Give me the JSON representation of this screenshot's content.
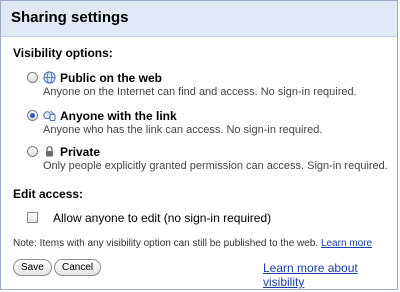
{
  "dialog": {
    "title": "Sharing settings"
  },
  "visibility": {
    "label": "Visibility options:",
    "options": [
      {
        "label": "Public on the web",
        "description": "Anyone on the Internet can find and access. No sign-in required.",
        "icon": "globe-icon",
        "selected": false
      },
      {
        "label": "Anyone with the link",
        "description": "Anyone who has the link can access. No sign-in required.",
        "icon": "link-icon",
        "selected": true
      },
      {
        "label": "Private",
        "description": "Only people explicitly granted permission can access. Sign-in required.",
        "icon": "lock-icon",
        "selected": false
      }
    ]
  },
  "edit_access": {
    "label": "Edit access:",
    "checkbox_label": "Allow anyone to edit (no sign-in required)",
    "checked": false
  },
  "note": {
    "text": "Note: Items with any visibility option can still be published to the web.",
    "link": "Learn more"
  },
  "buttons": {
    "save": "Save",
    "cancel": "Cancel"
  },
  "footer_link": "Learn more about visibility",
  "colors": {
    "titlebar": "#e1e9f6",
    "link": "#1a3fa6",
    "radio_selected": "#2d57b8"
  }
}
